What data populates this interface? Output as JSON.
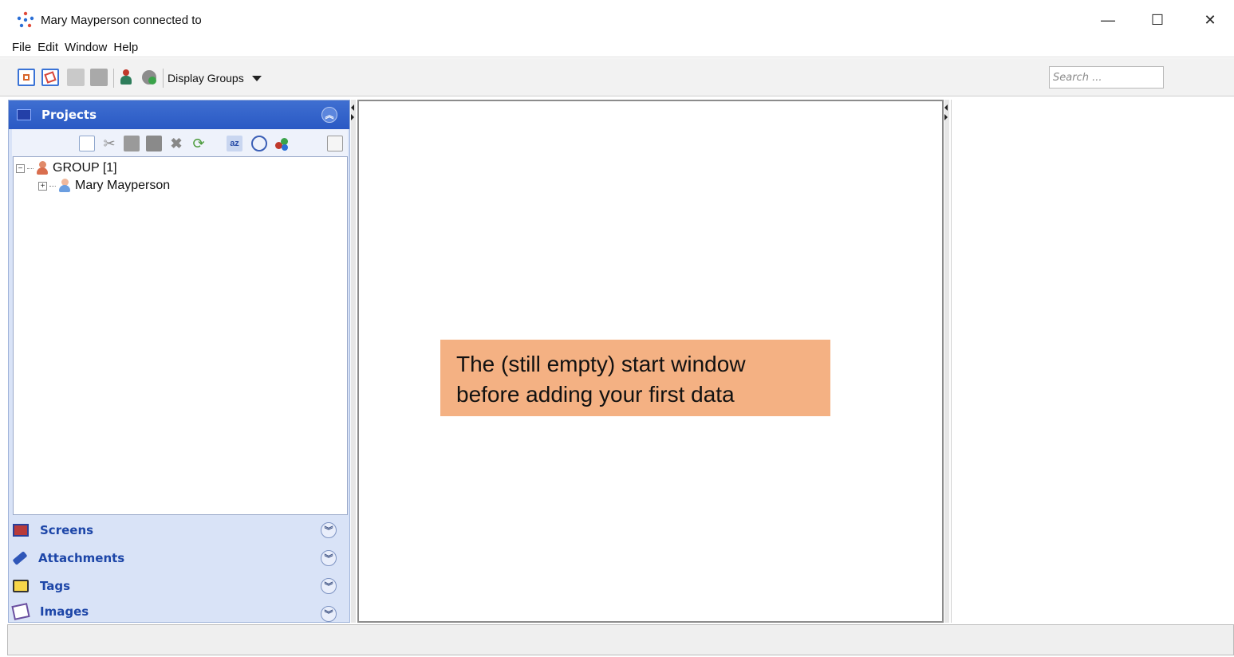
{
  "window": {
    "title": "Mary Mayperson connected to",
    "controls": {
      "minimize": "—",
      "maximize": "☐",
      "close": "✕"
    }
  },
  "menu": [
    "File",
    "Edit",
    "Window",
    "Help"
  ],
  "toolbar": {
    "display_groups_label": "Display Groups",
    "search_placeholder": "Search ..."
  },
  "projects_panel": {
    "title": "Projects",
    "tree": {
      "root": {
        "label": "GROUP [1]",
        "toggle": "−"
      },
      "child": {
        "label": "Mary Mayperson",
        "toggle": "+"
      }
    }
  },
  "sections": [
    {
      "label": "Screens",
      "icon": "screen-icon"
    },
    {
      "label": "Attachments",
      "icon": "pencil-icon"
    },
    {
      "label": "Tags",
      "icon": "tag-folder-icon"
    },
    {
      "label": "Images",
      "icon": "image-icon"
    }
  ],
  "annotation": {
    "line1": "The (still empty) start window",
    "line2": "before adding your first data"
  },
  "colors": {
    "panel_header": "#2a59c4",
    "panel_bg": "#d9e3f7",
    "section_text": "#1d46a8",
    "annotation_bg": "#f4b183"
  }
}
